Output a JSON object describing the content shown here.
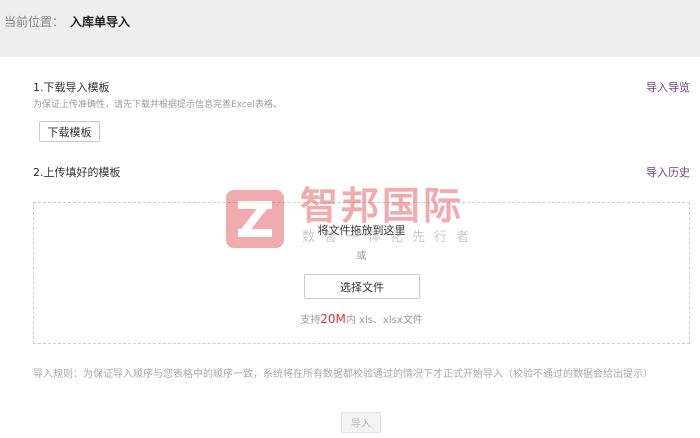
{
  "breadcrumb": {
    "label": "当前位置：",
    "current": "入库单导入"
  },
  "step1": {
    "title": "1.下载导入模板",
    "hint": "为保证上传准确性，请先下载并根据提示信息完善Excel表格。",
    "download_button": "下载模板",
    "preview_link": "导入导览"
  },
  "step2": {
    "title": "2.上传填好的模板",
    "history_link": "导入历史"
  },
  "upload": {
    "drop_text": "将文件拖放到这里",
    "or_text": "或",
    "select_button": "选择文件",
    "support_prefix": "支持",
    "support_size": "20M",
    "support_suffix": "内 xls、xlsx文件"
  },
  "watermark": {
    "name": "智邦国际",
    "slogan": "数智一体化先行者"
  },
  "rules": "导入规则：为保证导入顺序与您表格中的顺序一致，系统将在所有数据都校验通过的情况下才正式开始导入（校验不通过的数据会给出提示）",
  "import_button": "导入",
  "colors": {
    "accent": "#7b3c8e",
    "highlight": "#e0323c",
    "logo": "#e04a4a"
  }
}
